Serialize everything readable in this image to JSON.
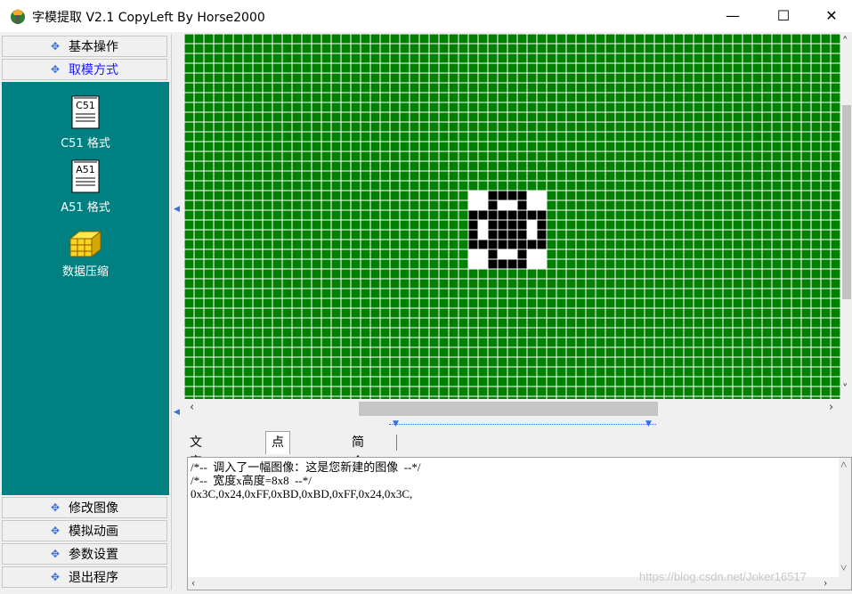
{
  "window": {
    "title": "字模提取 V2.1  CopyLeft By Horse2000",
    "minimize_glyph": "—",
    "maximize_glyph": "☐",
    "close_glyph": "✕"
  },
  "sidebar": {
    "top_buttons": [
      {
        "label": "基本操作",
        "active": false
      },
      {
        "label": "取模方式",
        "active": true
      }
    ],
    "tools": [
      {
        "label": "C51 格式",
        "icon": "c51-format-icon",
        "icon_text": "C51"
      },
      {
        "label": "A51 格式",
        "icon": "a51-format-icon",
        "icon_text": "A51"
      },
      {
        "label": "数据压缩",
        "icon": "data-compress-icon"
      }
    ],
    "bottom_buttons": [
      {
        "label": "修改图像"
      },
      {
        "label": "模拟动画"
      },
      {
        "label": "参数设置"
      },
      {
        "label": "退出程序"
      }
    ],
    "button_glyph": "✥"
  },
  "editor": {
    "grid_color": "#008000",
    "image_width": 8,
    "image_height": 8,
    "bitmap": [
      "00111100",
      "00100100",
      "11111111",
      "10111101",
      "10111101",
      "11111111",
      "00100100",
      "00111100"
    ]
  },
  "tabs": [
    {
      "label": "文字输入区",
      "active": false
    },
    {
      "label": "点阵生成区",
      "active": true
    },
    {
      "label": "简介",
      "active": false
    }
  ],
  "output": {
    "lines": [
      "/*--  调入了一幅图像：这是您新建的图像  --*/",
      "/*--  宽度x高度=8x8  --*/",
      "0x3C,0x24,0xFF,0xBD,0xBD,0xFF,0x24,0x3C,"
    ]
  },
  "watermark": "https://blog.csdn.net/Joker16517",
  "colors": {
    "teal": "#008080",
    "grid_green": "#008000",
    "accent_blue": "#1a1aff"
  }
}
